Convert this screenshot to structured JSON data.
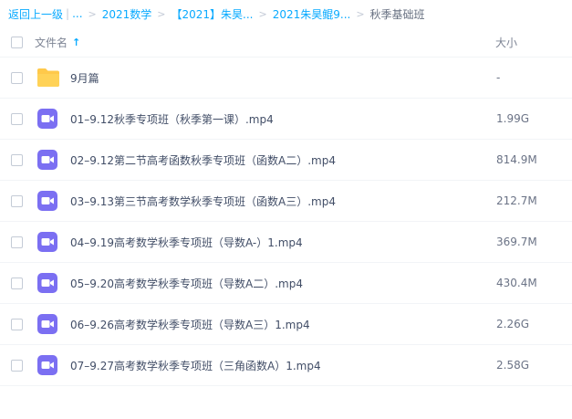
{
  "breadcrumb": {
    "back": "返回上一级",
    "ellipsis": "...",
    "items": [
      "2021数学",
      "【2021】朱昊...",
      "2021朱昊鲲9..."
    ],
    "current": "秋季基础班"
  },
  "header": {
    "name_label": "文件名",
    "size_label": "大小",
    "sort_icon": "sort-up-arrow"
  },
  "colors": {
    "link": "#09aaff",
    "folder": "#ffc94a",
    "video": "#7b6ff2"
  },
  "files": [
    {
      "name": "9月篇",
      "size": "-",
      "type": "folder"
    },
    {
      "name": "01–9.12秋季专项班（秋季第一课）.mp4",
      "size": "1.99G",
      "type": "video"
    },
    {
      "name": "02–9.12第二节高考函数秋季专项班（函数A二）.mp4",
      "size": "814.9M",
      "type": "video"
    },
    {
      "name": "03–9.13第三节高考数学秋季专项班（函数A三）.mp4",
      "size": "212.7M",
      "type": "video"
    },
    {
      "name": "04–9.19高考数学秋季专项班（导数A-）1.mp4",
      "size": "369.7M",
      "type": "video"
    },
    {
      "name": "05–9.20高考数学秋季专项班（导数A二）.mp4",
      "size": "430.4M",
      "type": "video"
    },
    {
      "name": "06–9.26高考数学秋季专项班（导数A三）1.mp4",
      "size": "2.26G",
      "type": "video"
    },
    {
      "name": "07–9.27高考数学秋季专项班（三角函数A）1.mp4",
      "size": "2.58G",
      "type": "video"
    }
  ]
}
